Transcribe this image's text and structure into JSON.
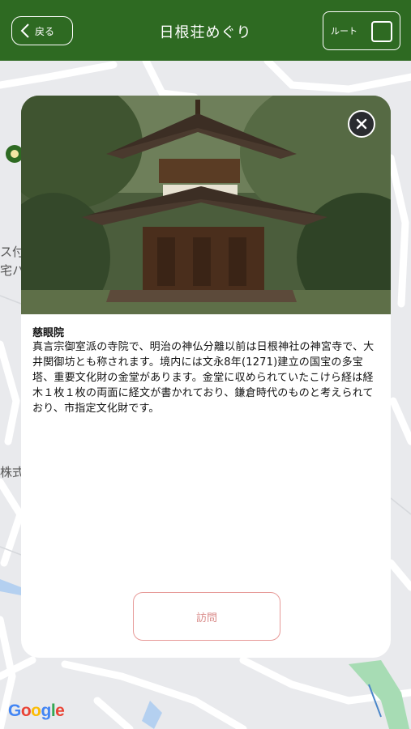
{
  "header": {
    "back_label": "戻る",
    "title": "日根荘めぐり",
    "route_label": "ルート"
  },
  "map": {
    "labels": [
      "ス付",
      "宅ハ",
      "株式"
    ],
    "attribution": "Google"
  },
  "card": {
    "place_name": "慈眼院",
    "description": "真言宗御室派の寺院で、明治の神仏分離以前は日根神社の神宮寺で、大井関御坊とも称されます。境内には文永8年(1271)建立の国宝の多宝塔、重要文化財の金堂があります。金堂に収められていたこけら経は経木１枚１枚の両面に経文が書かれており、鎌倉時代のものと考えられており、市指定文化財です。",
    "visit_label": "訪問"
  },
  "colors": {
    "header_green": "#2e6a22",
    "visit_border": "#e79a98",
    "close_bg": "#2a2c30"
  },
  "icons": [
    "back-chevron-icon",
    "route-checkbox-icon",
    "close-icon",
    "map-marker-icon"
  ]
}
